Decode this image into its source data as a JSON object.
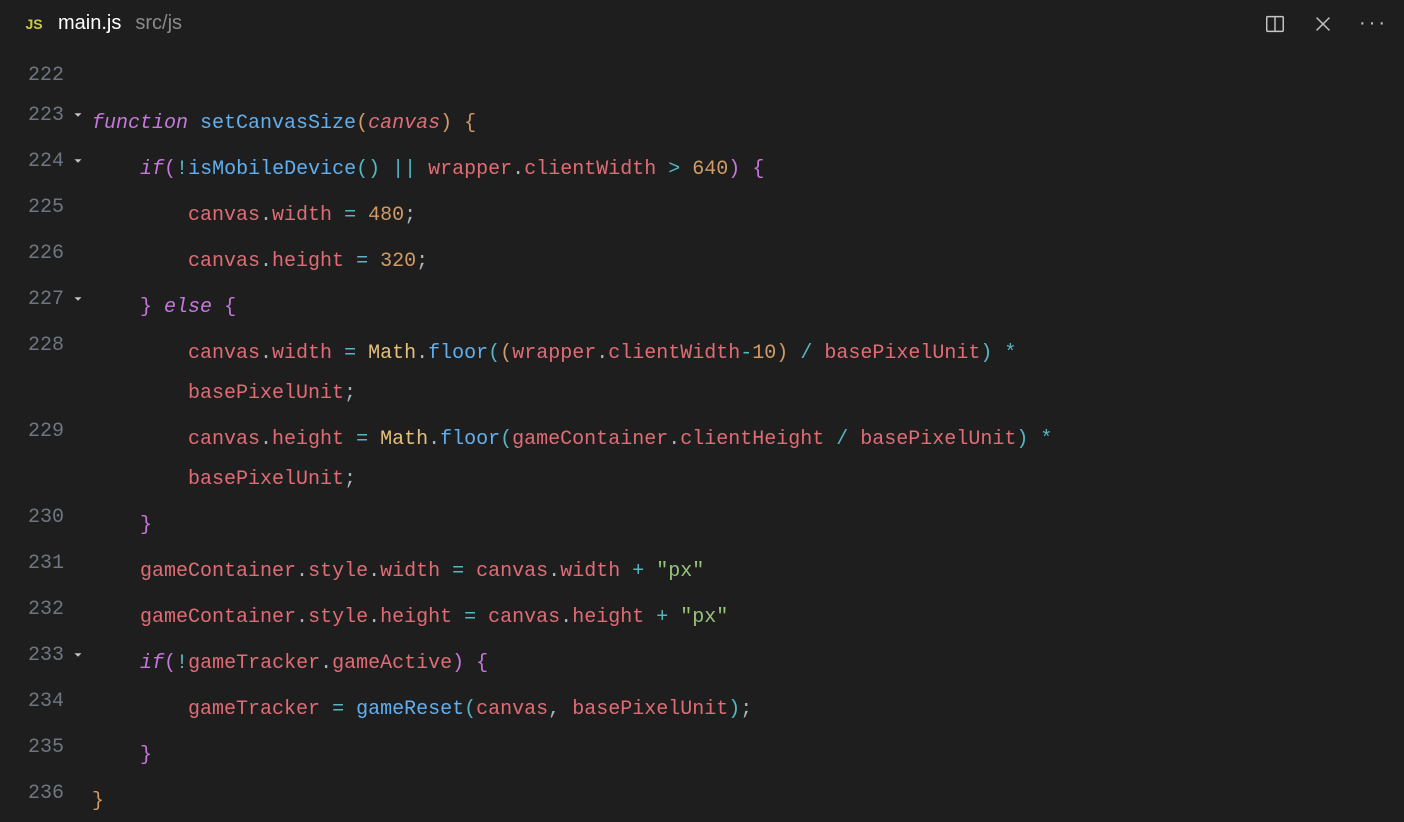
{
  "tab": {
    "icon_label": "JS",
    "filename": "main.js",
    "path": "src/js"
  },
  "lines": {
    "l222": {
      "no": "222"
    },
    "l223": {
      "no": "223",
      "kw": "function",
      "fn": "setCanvasSize",
      "param": "canvas"
    },
    "l224": {
      "no": "224",
      "kw": "if",
      "call": "isMobileDevice",
      "var1": "wrapper",
      "prop1": "clientWidth",
      "num1": "640"
    },
    "l225": {
      "no": "225",
      "var1": "canvas",
      "prop1": "width",
      "num1": "480"
    },
    "l226": {
      "no": "226",
      "var1": "canvas",
      "prop1": "height",
      "num1": "320"
    },
    "l227": {
      "no": "227",
      "kw": "else"
    },
    "l228": {
      "no": "228",
      "var1": "canvas",
      "prop1": "width",
      "obj": "Math",
      "fn": "floor",
      "var2": "wrapper",
      "prop2": "clientWidth",
      "num1": "10",
      "var3": "basePixelUnit",
      "wrap_var": "basePixelUnit"
    },
    "l229": {
      "no": "229",
      "var1": "canvas",
      "prop1": "height",
      "obj": "Math",
      "fn": "floor",
      "var2": "gameContainer",
      "prop2": "clientHeight",
      "var3": "basePixelUnit",
      "wrap_var": "basePixelUnit"
    },
    "l230": {
      "no": "230"
    },
    "l231": {
      "no": "231",
      "var1": "gameContainer",
      "prop1": "style",
      "prop2": "width",
      "var2": "canvas",
      "prop3": "width",
      "str": "\"px\""
    },
    "l232": {
      "no": "232",
      "var1": "gameContainer",
      "prop1": "style",
      "prop2": "height",
      "var2": "canvas",
      "prop3": "height",
      "str": "\"px\""
    },
    "l233": {
      "no": "233",
      "kw": "if",
      "var1": "gameTracker",
      "prop1": "gameActive"
    },
    "l234": {
      "no": "234",
      "var1": "gameTracker",
      "fn": "gameReset",
      "arg1": "canvas",
      "arg2": "basePixelUnit"
    },
    "l235": {
      "no": "235"
    },
    "l236": {
      "no": "236"
    }
  }
}
